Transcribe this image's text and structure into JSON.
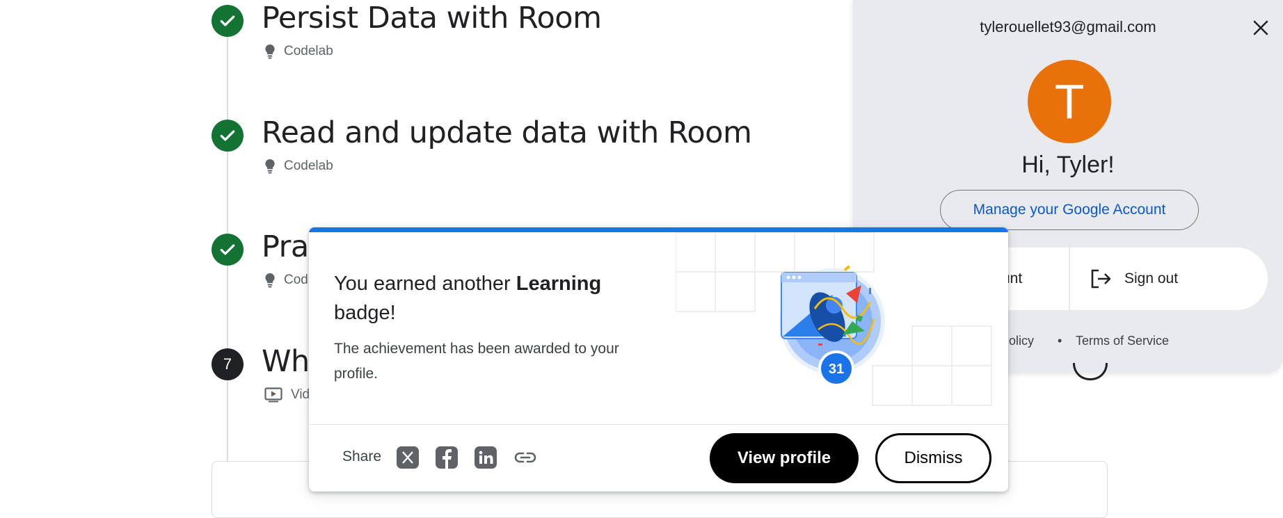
{
  "steps": [
    {
      "title": "Persist Data with Room",
      "status": "completed",
      "type_icon": "lightbulb-icon",
      "type_label": "Codelab"
    },
    {
      "title": "Read and update data with Room",
      "status": "completed",
      "type_icon": "lightbulb-icon",
      "type_label": "Codelab"
    },
    {
      "title": "Prac",
      "status": "completed",
      "type_icon": "lightbulb-icon",
      "type_label": "Cod"
    },
    {
      "title": "Wha",
      "number": "7",
      "type_icon": "video-icon",
      "type_label": "Vide"
    }
  ],
  "account_panel": {
    "email": "tylerouellet93@gmail.com",
    "avatar_letter": "T",
    "greeting": "Hi, Tyler!",
    "manage_label": "Manage your Google Account",
    "add_account_label": "unt",
    "sign_out_label": "Sign out",
    "privacy_label": "Policy",
    "separator": "•",
    "terms_label": "Terms of Service"
  },
  "badge_dialog": {
    "title_prefix": "You earned another ",
    "title_bold": "Learning",
    "title_suffix": "badge!",
    "description": "The achievement has been awarded to your profile.",
    "badge_count": "31",
    "share_label": "Share",
    "share_icons": [
      "x-icon",
      "facebook-icon",
      "linkedin-icon",
      "link-icon"
    ],
    "view_profile_label": "View profile",
    "dismiss_label": "Dismiss"
  },
  "colors": {
    "accent_blue": "#1a73e8",
    "completed_green": "#137333",
    "avatar_orange": "#e8710a",
    "link_blue": "#0b57d0"
  }
}
